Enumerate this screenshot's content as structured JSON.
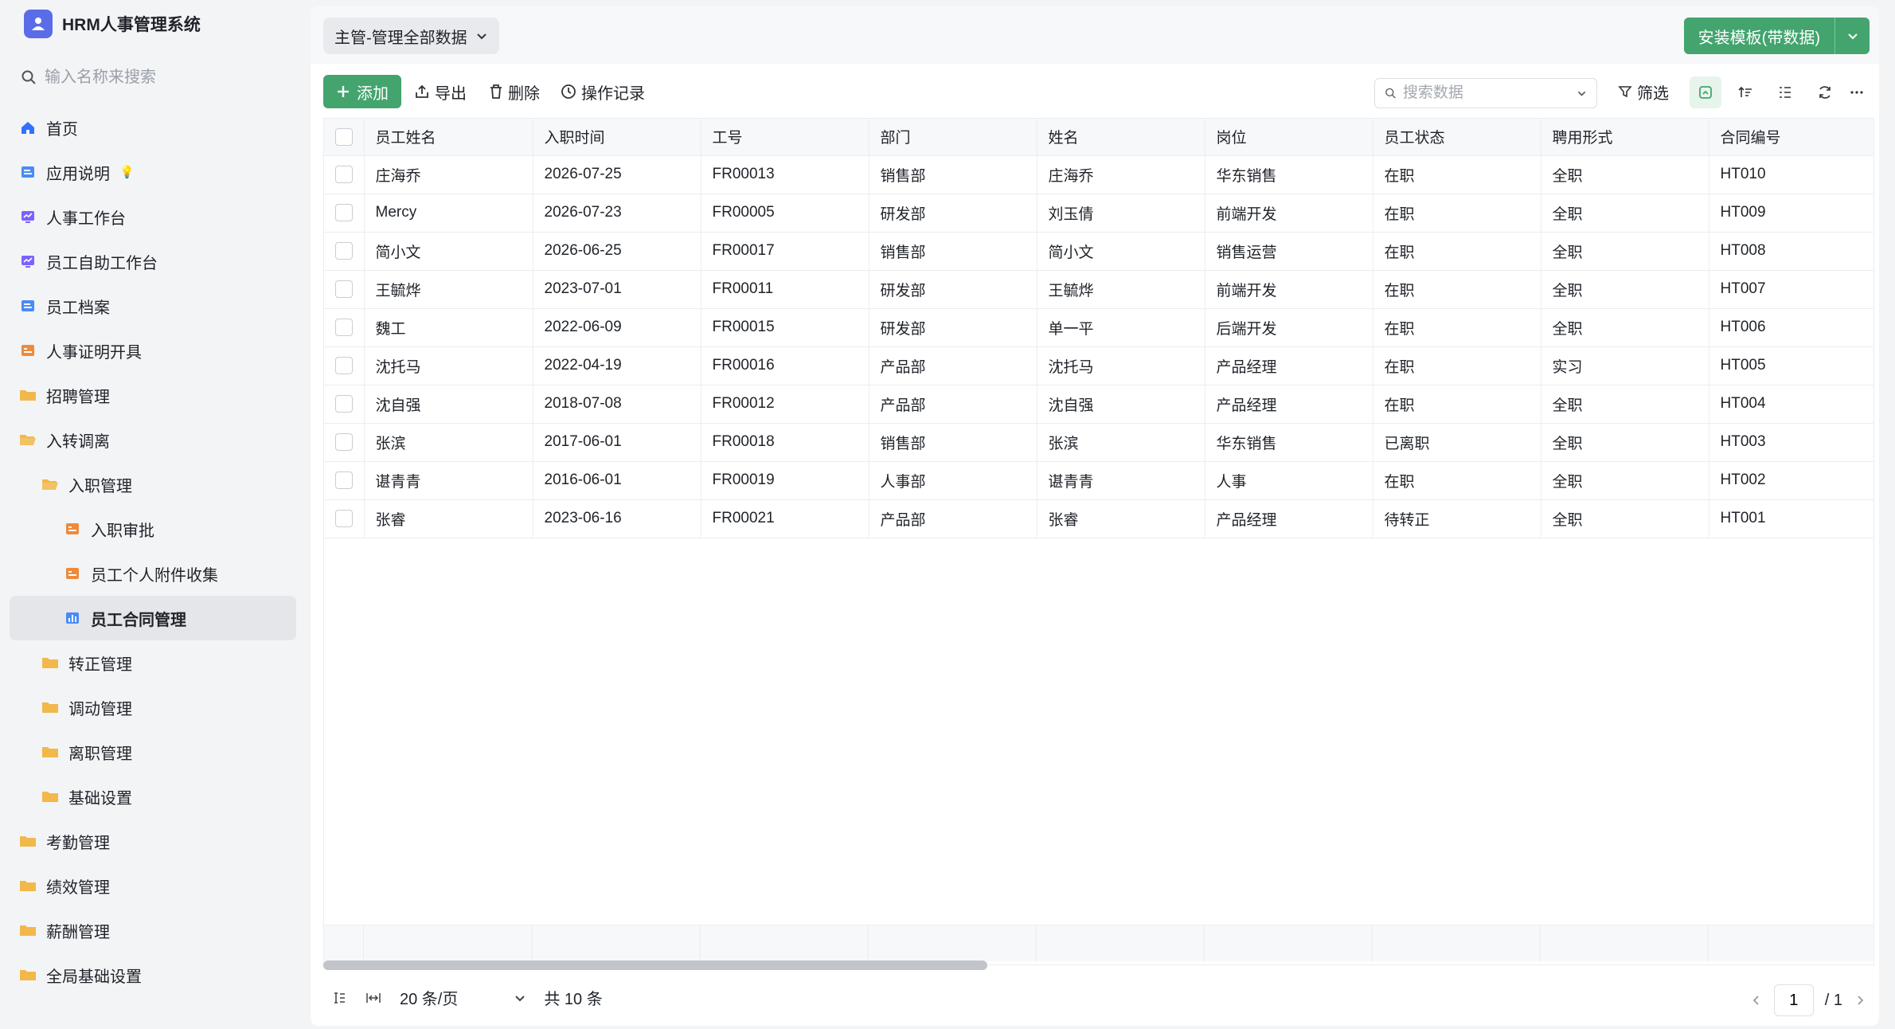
{
  "app": {
    "title": "HRM人事管理系统",
    "search_placeholder": "输入名称来搜索"
  },
  "sidebar": {
    "items": [
      {
        "label": "首页",
        "level": 0,
        "icon": "home-icon",
        "color": "#3370ff"
      },
      {
        "label": "应用说明",
        "level": 0,
        "icon": "doc-icon",
        "color": "#4a8bf5",
        "suffix": "💡"
      },
      {
        "label": "人事工作台",
        "level": 0,
        "icon": "dashboard-icon",
        "color": "#7b61ff"
      },
      {
        "label": "员工自助工作台",
        "level": 0,
        "icon": "dashboard-icon",
        "color": "#7b61ff"
      },
      {
        "label": "员工档案",
        "level": 0,
        "icon": "doc-icon",
        "color": "#4a8bf5"
      },
      {
        "label": "人事证明开具",
        "level": 0,
        "icon": "form-icon",
        "color": "#ee8a3a"
      },
      {
        "label": "招聘管理",
        "level": 0,
        "icon": "folder-icon",
        "color": "#f2b84b"
      },
      {
        "label": "入转调离",
        "level": 0,
        "icon": "folder-open-icon",
        "color": "#f2b84b"
      },
      {
        "label": "入职管理",
        "level": 1,
        "icon": "folder-open-icon",
        "color": "#f2b84b"
      },
      {
        "label": "入职审批",
        "level": 2,
        "icon": "form-icon",
        "color": "#ee8a3a"
      },
      {
        "label": "员工个人附件收集",
        "level": 2,
        "icon": "form-icon",
        "color": "#ee8a3a"
      },
      {
        "label": "员工合同管理",
        "level": 2,
        "icon": "chart-icon",
        "color": "#4a8bf5",
        "active": true
      },
      {
        "label": "转正管理",
        "level": 1,
        "icon": "folder-icon",
        "color": "#f2b84b"
      },
      {
        "label": "调动管理",
        "level": 1,
        "icon": "folder-icon",
        "color": "#f2b84b"
      },
      {
        "label": "离职管理",
        "level": 1,
        "icon": "folder-icon",
        "color": "#f2b84b"
      },
      {
        "label": "基础设置",
        "level": 1,
        "icon": "folder-icon",
        "color": "#f2b84b"
      },
      {
        "label": "考勤管理",
        "level": 0,
        "icon": "folder-icon",
        "color": "#f2b84b"
      },
      {
        "label": "绩效管理",
        "level": 0,
        "icon": "folder-icon",
        "color": "#f2b84b"
      },
      {
        "label": "薪酬管理",
        "level": 0,
        "icon": "folder-icon",
        "color": "#f2b84b"
      },
      {
        "label": "全局基础设置",
        "level": 0,
        "icon": "folder-icon",
        "color": "#f2b84b"
      }
    ]
  },
  "header": {
    "view_label": "主管-管理全部数据",
    "install_label": "安装模板(带数据)"
  },
  "toolbar": {
    "add_label": "添加",
    "export_label": "导出",
    "delete_label": "删除",
    "log_label": "操作记录",
    "search_placeholder": "搜索数据",
    "filter_label": "筛选"
  },
  "table": {
    "columns": [
      "员工姓名",
      "入职时间",
      "工号",
      "部门",
      "姓名",
      "岗位",
      "员工状态",
      "聘用形式",
      "合同编号"
    ],
    "rows": [
      [
        "庄海乔",
        "2026-07-25",
        "FR00013",
        "销售部",
        "庄海乔",
        "华东销售",
        "在职",
        "全职",
        "HT010"
      ],
      [
        "Mercy",
        "2026-07-23",
        "FR00005",
        "研发部",
        "刘玉倩",
        "前端开发",
        "在职",
        "全职",
        "HT009"
      ],
      [
        "简小文",
        "2026-06-25",
        "FR00017",
        "销售部",
        "简小文",
        "销售运营",
        "在职",
        "全职",
        "HT008"
      ],
      [
        "王毓烨",
        "2023-07-01",
        "FR00011",
        "研发部",
        "王毓烨",
        "前端开发",
        "在职",
        "全职",
        "HT007"
      ],
      [
        "魏工",
        "2022-06-09",
        "FR00015",
        "研发部",
        "单一平",
        "后端开发",
        "在职",
        "全职",
        "HT006"
      ],
      [
        "沈托马",
        "2022-04-19",
        "FR00016",
        "产品部",
        "沈托马",
        "产品经理",
        "在职",
        "实习",
        "HT005"
      ],
      [
        "沈自强",
        "2018-07-08",
        "FR00012",
        "产品部",
        "沈自强",
        "产品经理",
        "在职",
        "全职",
        "HT004"
      ],
      [
        "张滨",
        "2017-06-01",
        "FR00018",
        "销售部",
        "张滨",
        "华东销售",
        "已离职",
        "全职",
        "HT003"
      ],
      [
        "谌青青",
        "2016-06-01",
        "FR00019",
        "人事部",
        "谌青青",
        "人事",
        "在职",
        "全职",
        "HT002"
      ],
      [
        "张睿",
        "2023-06-16",
        "FR00021",
        "产品部",
        "张睿",
        "产品经理",
        "待转正",
        "全职",
        "HT001"
      ]
    ]
  },
  "pager": {
    "page_size": "20 条/页",
    "total": "共 10 条",
    "current_page": "1",
    "total_pages": "/ 1"
  },
  "colors": {
    "accent": "#43a46e",
    "brand": "#5b6ce8"
  }
}
